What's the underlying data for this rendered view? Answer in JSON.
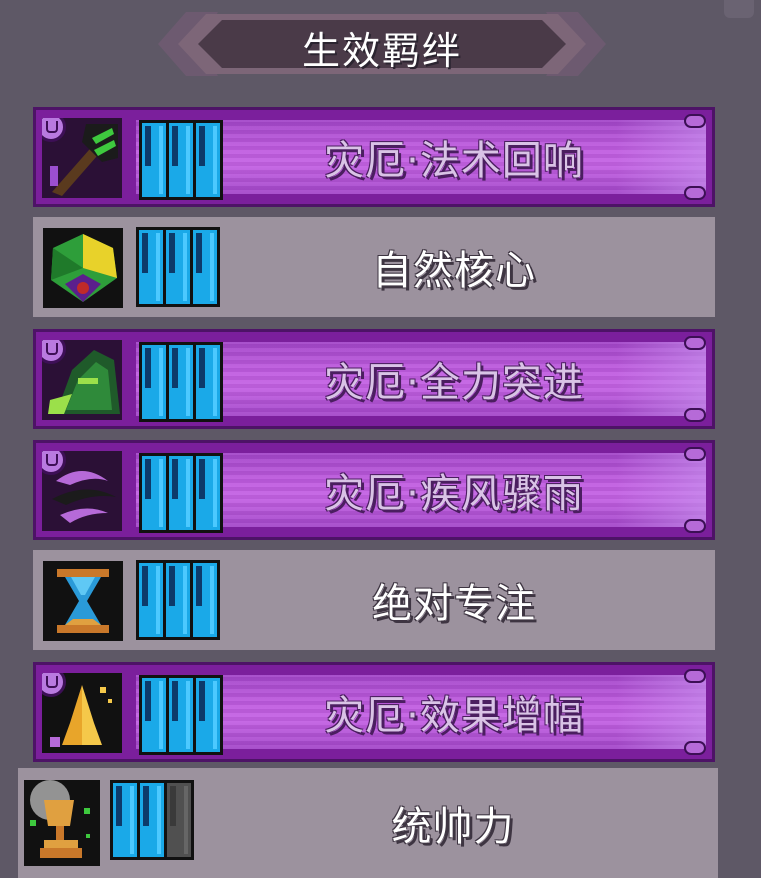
{
  "panel": {
    "title": "生效羁绊"
  },
  "bonds": [
    {
      "name": "灾厄·法术回响",
      "curse": true,
      "icon": "magic-staff-icon",
      "level": 3,
      "max_level": 3
    },
    {
      "name": "自然核心",
      "curse": false,
      "icon": "nature-gem-icon",
      "level": 3,
      "max_level": 3
    },
    {
      "name": "灾厄·全力突进",
      "curse": true,
      "icon": "green-beast-icon",
      "level": 3,
      "max_level": 3
    },
    {
      "name": "灾厄·疾风骤雨",
      "curse": true,
      "icon": "wind-swirl-icon",
      "level": 3,
      "max_level": 3
    },
    {
      "name": "绝对专注",
      "curse": false,
      "icon": "hourglass-icon",
      "level": 3,
      "max_level": 3
    },
    {
      "name": "灾厄·效果增幅",
      "curse": true,
      "icon": "praying-hands-icon",
      "level": 3,
      "max_level": 3
    },
    {
      "name": "统帅力",
      "curse": false,
      "icon": "golden-trophy-icon",
      "level": 2,
      "max_level": 3
    }
  ],
  "colors": {
    "curse_row": "#7b1f9c",
    "normal_row": "#9c929e",
    "level_bar": "#1aa9e8",
    "level_bar_empty": "#505050"
  }
}
